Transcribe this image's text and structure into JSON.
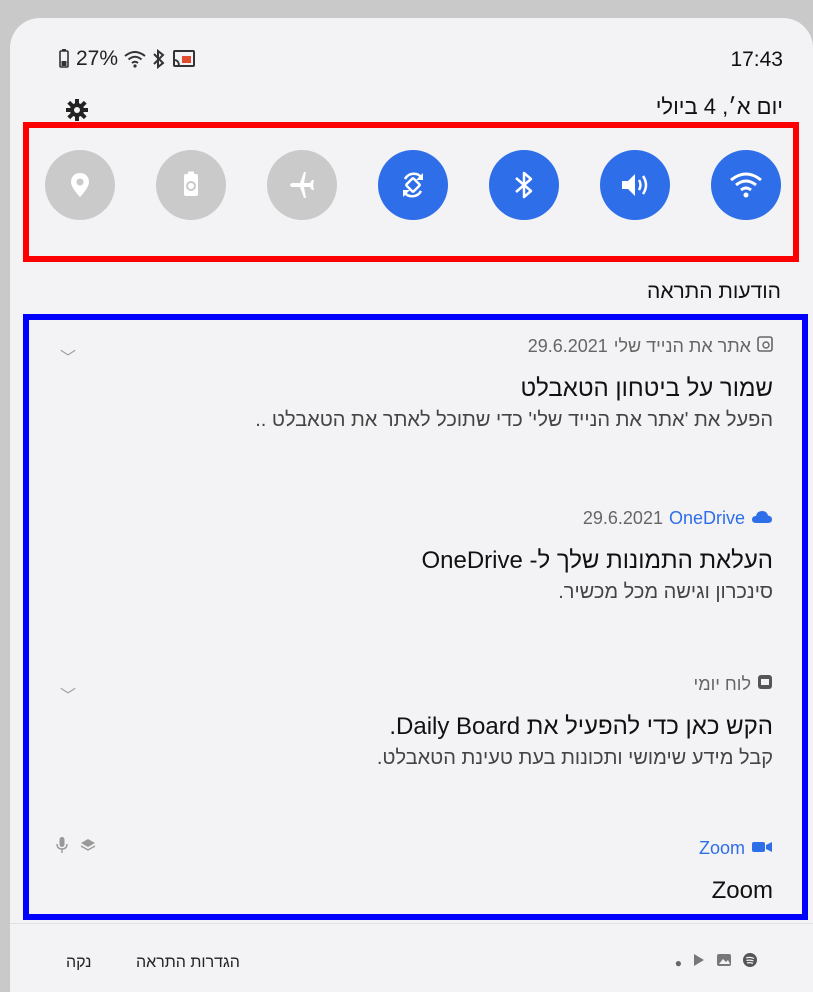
{
  "status_bar": {
    "battery": "27%",
    "time": "17:43",
    "date": "יום א׳, 4 ביולי"
  },
  "quick_settings": [
    {
      "name": "location",
      "icon": "location-pin-icon",
      "state": "off"
    },
    {
      "name": "battery-saver",
      "icon": "battery-recycle-icon",
      "state": "off"
    },
    {
      "name": "airplane",
      "icon": "airplane-icon",
      "state": "off"
    },
    {
      "name": "auto-rotate",
      "icon": "rotate-icon",
      "state": "on"
    },
    {
      "name": "bluetooth",
      "icon": "bluetooth-icon",
      "state": "on"
    },
    {
      "name": "sound",
      "icon": "speaker-icon",
      "state": "on"
    },
    {
      "name": "wifi",
      "icon": "wifi-icon",
      "state": "on"
    }
  ],
  "section_title": "הודעות התראה",
  "notifications": [
    {
      "app": "אתר את הנייד שלי",
      "date": "29.6.2021",
      "title": "שמור על ביטחון הטאבלט",
      "text": "הפעל את 'אתר את הנייד שלי' כדי שתוכל לאתר את הטאבלט .."
    },
    {
      "app": "OneDrive",
      "date": "29.6.2021",
      "title": "העלאת התמונות שלך ל- OneDrive",
      "text": "סינכרון וגישה מכל מכשיר."
    },
    {
      "app": "לוח יומי",
      "title": "הקש כאן כדי להפעיל את Daily Board.",
      "text": "קבל מידע שימושי ותכונות בעת טעינת הטאבלט."
    },
    {
      "app": "Zoom",
      "title": "Zoom"
    }
  ],
  "footer": {
    "clear": "נקה",
    "settings": "הגדרות התראה"
  },
  "colors": {
    "accent": "#2f6ee9",
    "off": "#cacaca",
    "highlight_red": "#ff0000",
    "highlight_blue": "#0000ff"
  }
}
